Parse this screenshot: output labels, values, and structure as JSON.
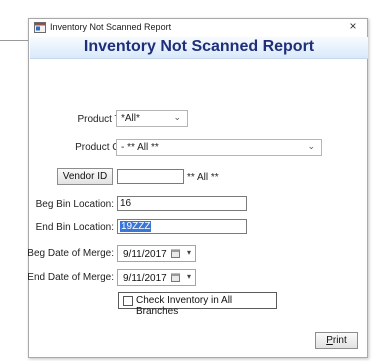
{
  "window": {
    "title": "Inventory Not Scanned Report",
    "close_symbol": "×",
    "header_title": "Inventory Not Scanned Report"
  },
  "form": {
    "product_type": {
      "label": "Product Type:",
      "value": "*All*"
    },
    "product_code": {
      "label": "Product Code:",
      "value": "- ** All **"
    },
    "vendor": {
      "button_label": "Vendor ID",
      "value": "",
      "all_text": "** All **"
    },
    "beg_bin": {
      "label": "Beg Bin Location:",
      "value": "16"
    },
    "end_bin": {
      "label": "End Bin Location:",
      "value": "19ZZZ"
    },
    "beg_date": {
      "label": "Beg Date of Merge:",
      "value": "9/11/2017"
    },
    "end_date": {
      "label": "End Date of Merge:",
      "value": "9/11/2017"
    },
    "check_branches": {
      "label": "Check Inventory in All Branches",
      "checked": false
    }
  },
  "footer": {
    "print_first": "P",
    "print_rest": "rint"
  },
  "colors": {
    "header_text": "#1f2f7a",
    "selection": "#3a76d8"
  },
  "icons": {
    "app": "app-window-icon",
    "close": "close-icon",
    "chevron": "chevron-down-icon",
    "calendar": "calendar-icon"
  }
}
